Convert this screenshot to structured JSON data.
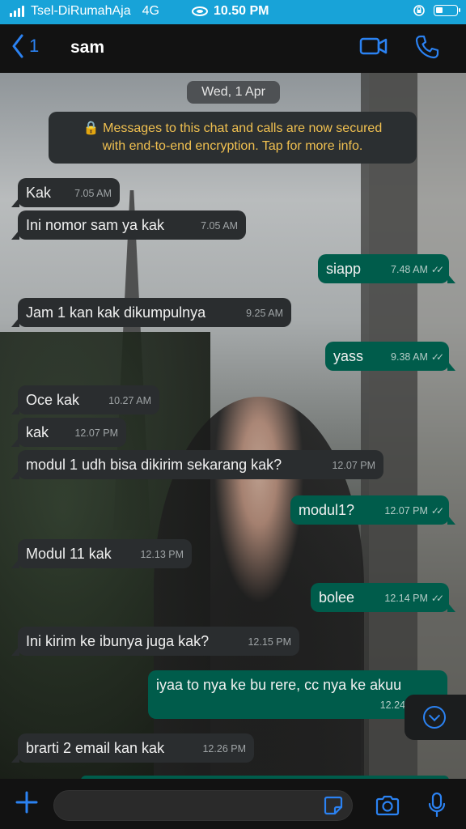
{
  "status_bar": {
    "carrier": "Tsel-DiRumahAja",
    "network": "4G",
    "time": "10.50 PM",
    "accent_color": "#18a3d8"
  },
  "header": {
    "back_count": "1",
    "contact_name": "sam",
    "icons": [
      "back-chevron-icon",
      "video-call-icon",
      "voice-call-icon"
    ],
    "accent_color": "#2b82f2"
  },
  "chat": {
    "date": "Wed, 1 Apr",
    "encryption_notice_line1": "🔒 Messages to this chat and calls are now secured",
    "encryption_notice_line2": "with end-to-end encryption. Tap for more info.",
    "messages": [
      {
        "dir": "in",
        "text": "Kak",
        "time": "7.05 AM"
      },
      {
        "dir": "in",
        "text": "Ini nomor sam ya kak",
        "time": "7.05 AM"
      },
      {
        "dir": "out",
        "text": "siapp",
        "time": "7.48 AM"
      },
      {
        "dir": "in",
        "text": "Jam 1 kan kak dikumpulnya",
        "time": "9.25 AM"
      },
      {
        "dir": "out",
        "text": "yass",
        "time": "9.38 AM"
      },
      {
        "dir": "in",
        "text": "Oce kak",
        "time": "10.27 AM"
      },
      {
        "dir": "in",
        "text": "kak",
        "time": "12.07 PM"
      },
      {
        "dir": "in",
        "text": "modul 1 udh bisa dikirim sekarang kak?",
        "time": "12.07 PM"
      },
      {
        "dir": "out",
        "text": "modul1?",
        "time": "12.07 PM"
      },
      {
        "dir": "in",
        "text": "Modul 11 kak",
        "time": "12.13 PM"
      },
      {
        "dir": "out",
        "text": "bolee",
        "time": "12.14 PM"
      },
      {
        "dir": "in",
        "text": "Ini kirim ke ibunya juga kak?",
        "time": "12.15 PM"
      },
      {
        "dir": "out",
        "text": "iyaa to nya ke bu rere, cc nya ke akuu",
        "time": "12.24"
      },
      {
        "dir": "in",
        "text": "brarti 2 email kan kak",
        "time": "12.26 PM"
      }
    ],
    "read_ticks": "✓✓",
    "incoming_color": "#2a2d2f",
    "outgoing_color": "#005c4b"
  },
  "composer": {
    "input_value": "",
    "icons": [
      "plus-icon",
      "sticker-icon",
      "camera-icon",
      "microphone-icon"
    ]
  }
}
